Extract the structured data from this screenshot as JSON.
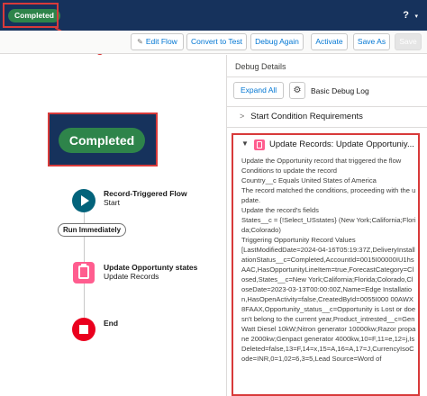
{
  "header": {
    "status_badge": "Completed",
    "help_label": "?",
    "help_caret": "▾"
  },
  "toolbar": {
    "edit_flow": "Edit Flow",
    "convert_to_test": "Convert to Test",
    "debug_again": "Debug Again",
    "activate": "Activate",
    "save_as": "Save As",
    "save": "Save"
  },
  "callout": {
    "status_badge": "Completed"
  },
  "flow": {
    "start": {
      "title": "Record-Triggered Flow",
      "subtitle": "Start"
    },
    "path_label": "Run Immediately",
    "update": {
      "title": "Update Opportunty states",
      "subtitle": "Update Records"
    },
    "end": {
      "title": "End"
    }
  },
  "debug": {
    "title": "Debug Details",
    "expand_all": "Expand All",
    "log_mode": "Basic Debug Log",
    "start_condition": "Start Condition Requirements",
    "detail_title": "Update Records: Update Opportuniy...",
    "detail_lines": [
      "Update the Opportunity record that triggered the flow",
      "Conditions to update the record",
      "Country__c Equals United States of America",
      "The record matched the conditions, proceeding with the update.",
      "Update the record's fields",
      "States__c = {!Select_USstates} (New York;California;Florida;Colorado)",
      "Triggering Opportunity Record Values",
      "[LastModifiedDate=2024-04-16T05:19:37Z,DeliveryInstallationStatus__c=Completed,AccountId=0015I00000IU1hsAAC,HasOpportunityLineItem=true,ForecastCategory=Closed,States__c=New York;California;Florida;Colorado,CloseDate=2023-03-13T00:00:00Z,Name=Edge Installation,HasOpenActivity=false,CreatedById=0055I000 00AWX8FAAX,Opportunity_status__c=Opportunity is Lost or doesn't belong to the current year,Product_intrested__c=GenWatt Diesel 10kW;Nitron generator 10000kw;Razor propane 2000kw;Genpact generator 4000kw,10=F,11=e,12=j,IsDeleted=false,13=F,14=x,15=A,16=A,17=J,CurrencyIsoCode=INR,0=1,02=6,3=5,Lead Source=Word of"
    ]
  }
}
